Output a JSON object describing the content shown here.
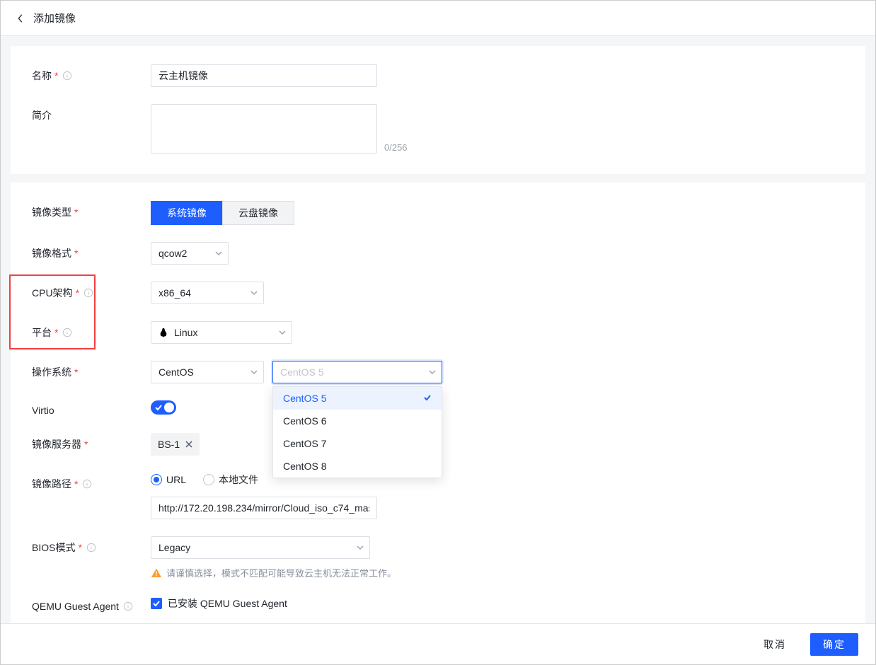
{
  "header": {
    "title": "添加镜像"
  },
  "section1": {
    "name_label": "名称",
    "name_value": "云主机镜像",
    "desc_label": "简介",
    "char_count": "0/256"
  },
  "section2": {
    "image_type_label": "镜像类型",
    "image_type_options": [
      "系统镜像",
      "云盘镜像"
    ],
    "format_label": "镜像格式",
    "format_value": "qcow2",
    "cpu_label": "CPU架构",
    "cpu_value": "x86_64",
    "platform_label": "平台",
    "platform_value": "Linux",
    "os_label": "操作系统",
    "os_value": "CentOS",
    "os_version_placeholder": "CentOS 5",
    "os_version_options": [
      "CentOS 5",
      "CentOS 6",
      "CentOS 7",
      "CentOS 8"
    ],
    "virtio_label": "Virtio",
    "server_label": "镜像服务器",
    "server_tag": "BS-1",
    "path_label": "镜像路径",
    "path_options": [
      "URL",
      "本地文件"
    ],
    "path_value": "http://172.20.198.234/mirror/Cloud_iso_c74_mas",
    "bios_label": "BIOS模式",
    "bios_value": "Legacy",
    "bios_warn": "请谨慎选择，模式不匹配可能导致云主机无法正常工作。",
    "qemu_label": "QEMU Guest Agent",
    "qemu_check_label": "已安装 QEMU Guest Agent"
  },
  "footer": {
    "cancel": "取消",
    "confirm": "确定"
  }
}
